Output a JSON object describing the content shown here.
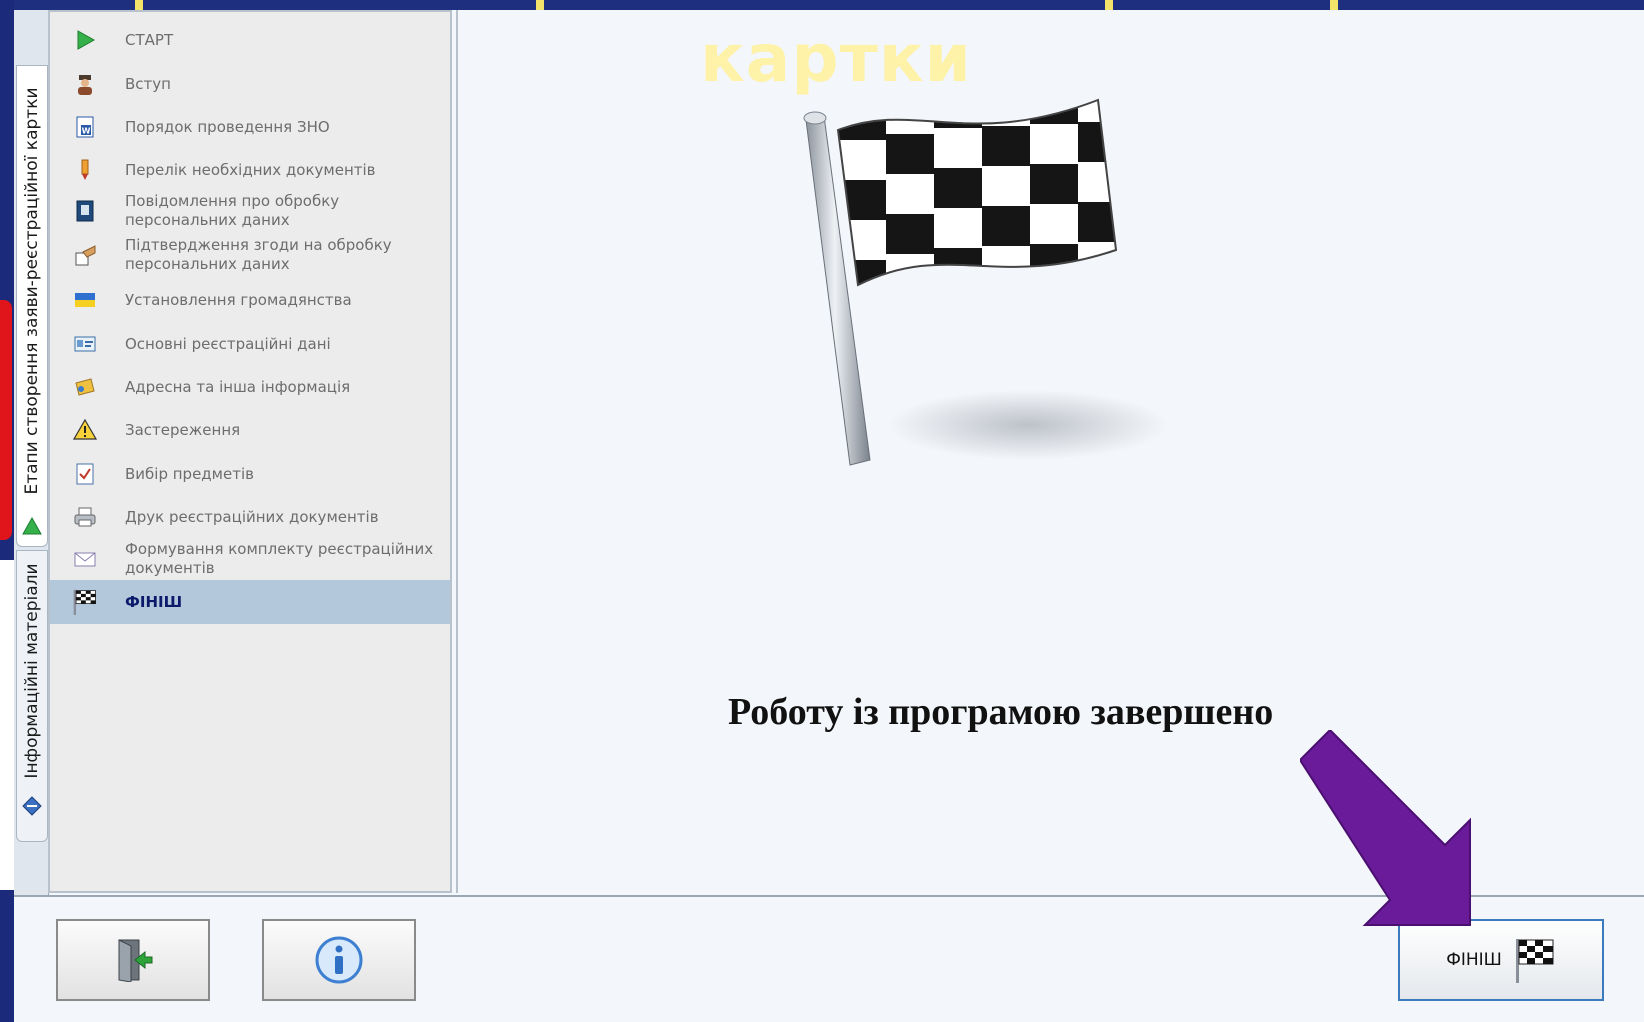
{
  "background": {
    "title_fragment": "картки"
  },
  "vertical_tabs": [
    {
      "label": "Етапи створення заяви-реєстраційної картки",
      "icon": "green-triangle-icon",
      "active": true
    },
    {
      "label": "Інформаційні матеріали",
      "icon": "blue-diamond-icon",
      "active": false
    }
  ],
  "nav": {
    "items": [
      {
        "label": "СТАРТ",
        "icon": "play-icon"
      },
      {
        "label": "Вступ",
        "icon": "person-icon"
      },
      {
        "label": "Порядок проведення ЗНО",
        "icon": "word-document-icon"
      },
      {
        "label": "Перелік необхідних документів",
        "icon": "pen-icon"
      },
      {
        "label": "Повідомлення про обробку персональних даних",
        "icon": "id-book-icon"
      },
      {
        "label": "Підтвердження згоди на обробку персональних даних",
        "icon": "handshake-icon"
      },
      {
        "label": "Установлення громадянства",
        "icon": "ukraine-flag-icon"
      },
      {
        "label": "Основні реєстраційні дані",
        "icon": "id-card-icon"
      },
      {
        "label": "Адресна та інша інформація",
        "icon": "address-book-icon"
      },
      {
        "label": "Застереження",
        "icon": "warning-icon"
      },
      {
        "label": "Вибір предметів",
        "icon": "checklist-icon"
      },
      {
        "label": "Друк реєстраційних документів",
        "icon": "printer-icon"
      },
      {
        "label": "Формування комплекту реєстраційних документів",
        "icon": "envelope-icon"
      },
      {
        "label": "ФІНІШ",
        "icon": "checkered-flag-icon",
        "selected": true
      }
    ]
  },
  "main": {
    "illustration": "checkered-flag-icon",
    "message": "Роботу із програмою завершено"
  },
  "bottom_bar": {
    "exit_button_icon": "exit-door-icon",
    "info_button_icon": "info-icon",
    "finish_button_label": "ФІНІШ",
    "finish_button_icon": "checkered-flag-icon"
  },
  "overlay": {
    "arrow_color": "#6a1b9a",
    "arrow_icon": "arrow-pointer-icon"
  },
  "colors": {
    "selection": "#b4c8dc",
    "accent": "#3b7bbd",
    "slide_blue": "#1b2a7a",
    "slide_red": "#e0141b"
  }
}
